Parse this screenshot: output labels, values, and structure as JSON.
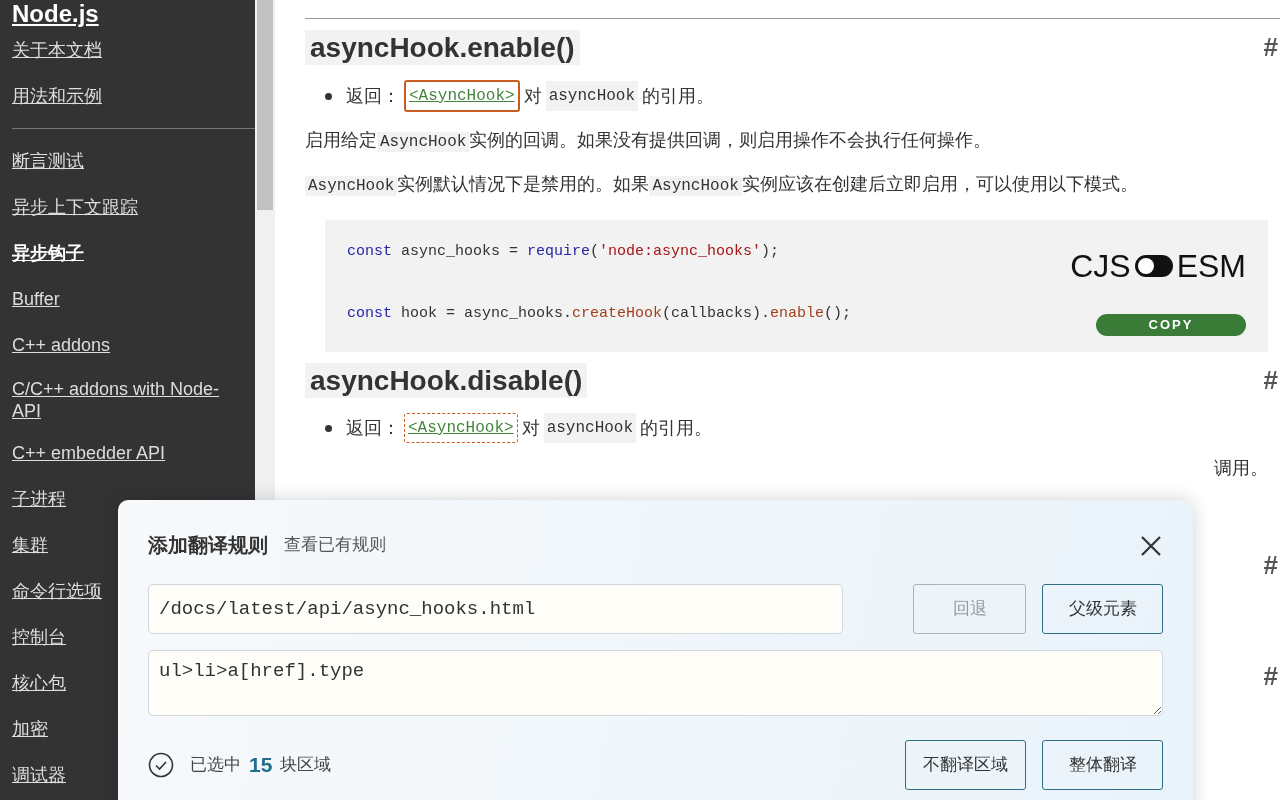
{
  "sidebar": {
    "title": "Node.js",
    "groups": [
      [
        {
          "label": "关于本文档",
          "selected": false
        },
        {
          "label": "用法和示例",
          "selected": false
        }
      ],
      [
        {
          "label": "断言测试",
          "selected": false
        },
        {
          "label": "异步上下文跟踪",
          "selected": false
        },
        {
          "label": "异步钩子",
          "selected": true
        },
        {
          "label": "Buffer",
          "selected": false
        },
        {
          "label": "C++ addons",
          "selected": false
        },
        {
          "label": "C/C++ addons with Node-API",
          "selected": false
        },
        {
          "label": "C++ embedder API",
          "selected": false
        },
        {
          "label": "子进程",
          "selected": false
        },
        {
          "label": "集群",
          "selected": false
        },
        {
          "label": "命令行选项",
          "selected": false
        },
        {
          "label": "控制台",
          "selected": false
        },
        {
          "label": "核心包",
          "selected": false
        },
        {
          "label": "加密",
          "selected": false
        },
        {
          "label": "调试器",
          "selected": false
        }
      ]
    ]
  },
  "content": [
    {
      "kind": "heading",
      "text": "asyncHook.enable()",
      "anchor": "#"
    },
    {
      "kind": "bullet",
      "parts": [
        {
          "kind": "text",
          "text": "返回："
        },
        {
          "kind": "link",
          "text": "<AsyncHook>",
          "hovered": true
        },
        {
          "kind": "text",
          "text": "对"
        },
        {
          "kind": "code",
          "text": "asyncHook"
        },
        {
          "kind": "text",
          "text": "的引用。"
        }
      ]
    },
    {
      "kind": "para",
      "parts": [
        {
          "kind": "text",
          "text": "启用给定"
        },
        {
          "kind": "code",
          "text": "AsyncHook"
        },
        {
          "kind": "text",
          "text": "实例的回调。如果没有提供回调，则启用操作不会执行任何操作。"
        }
      ]
    },
    {
      "kind": "para",
      "parts": [
        {
          "kind": "code",
          "text": "AsyncHook"
        },
        {
          "kind": "text",
          "text": "实例默认情况下是禁用的。如果"
        },
        {
          "kind": "code",
          "text": "AsyncHook"
        },
        {
          "kind": "text",
          "text": "实例应该在创建后立即启用，可以使用以下模式。"
        }
      ]
    },
    {
      "kind": "codeblock",
      "toggle": {
        "left": "CJS",
        "right": "ESM",
        "on": false
      },
      "copy": "COPY",
      "lines": [
        [
          {
            "kind": "keyword",
            "text": "const"
          },
          {
            "kind": "plain",
            "text": " async_hooks = "
          },
          {
            "kind": "keyword",
            "text": "require"
          },
          {
            "kind": "plain",
            "text": "("
          },
          {
            "kind": "string",
            "text": "'node:async_hooks'"
          },
          {
            "kind": "plain",
            "text": ");"
          }
        ],
        [
          {
            "kind": "keyword",
            "text": "const"
          },
          {
            "kind": "plain",
            "text": " hook = async_hooks."
          },
          {
            "kind": "func",
            "text": "createHook"
          },
          {
            "kind": "plain",
            "text": "(callbacks)."
          },
          {
            "kind": "func",
            "text": "enable"
          },
          {
            "kind": "plain",
            "text": "();"
          }
        ]
      ]
    },
    {
      "kind": "heading",
      "text": "asyncHook.disable()",
      "anchor": "#"
    },
    {
      "kind": "bullet",
      "parts": [
        {
          "kind": "text",
          "text": "返回："
        },
        {
          "kind": "link",
          "text": "<AsyncHook>",
          "hovered": false
        },
        {
          "kind": "text",
          "text": "对"
        },
        {
          "kind": "code",
          "text": "asyncHook"
        },
        {
          "kind": "text",
          "text": "的引用。"
        }
      ]
    },
    {
      "kind": "tail",
      "text": "调用。"
    },
    {
      "kind": "anchor",
      "text": "#"
    },
    {
      "kind": "anchor",
      "text": "#"
    }
  ],
  "dialog": {
    "title": "添加翻译规则",
    "view_link": "查看已有规则",
    "url_value": "/docs/latest/api/async_hooks.html",
    "back_button": {
      "label": "回退",
      "disabled": true
    },
    "parent_button": "父级元素",
    "selector_value": "ul>li>a[href].type",
    "status": {
      "prefix": "已选中",
      "count": "15",
      "suffix": "块区域"
    },
    "buttons": [
      "不翻译区域",
      "整体翻译"
    ]
  }
}
